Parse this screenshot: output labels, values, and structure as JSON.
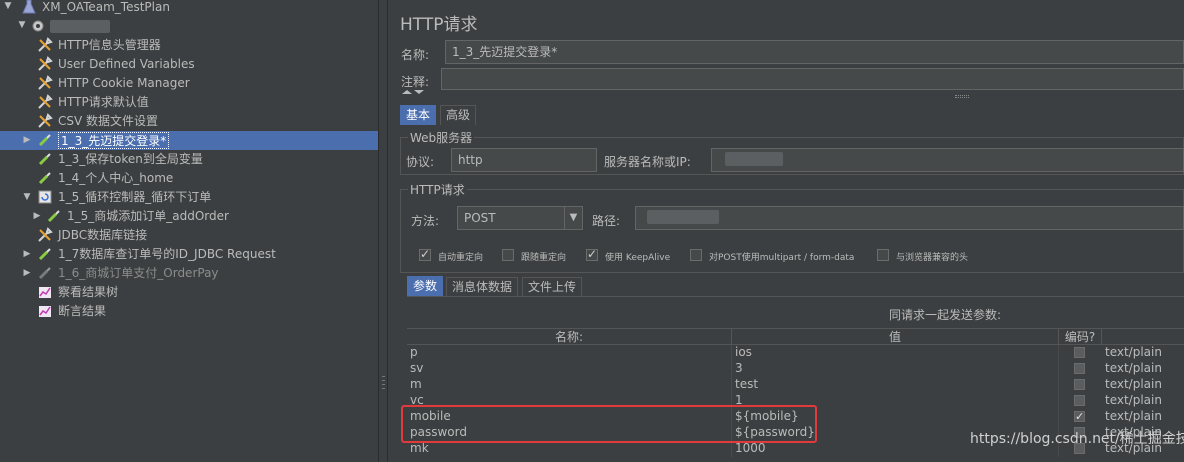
{
  "tree": {
    "items": [
      {
        "label": "XM_OATeam_TestPlan",
        "icon": "flask-icon"
      },
      {
        "label": "",
        "icon": "gear-icon"
      },
      {
        "label": "HTTP信息头管理器",
        "icon": "wrench-icon"
      },
      {
        "label": "User Defined Variables",
        "icon": "wrench-icon"
      },
      {
        "label": "HTTP Cookie Manager",
        "icon": "wrench-icon"
      },
      {
        "label": "HTTP请求默认值",
        "icon": "wrench-icon"
      },
      {
        "label": "CSV 数据文件设置",
        "icon": "wrench-icon"
      },
      {
        "label": "1_3_先迈提交登录*",
        "icon": "pipette-icon"
      },
      {
        "label": "1_3_保存token到全局变量",
        "icon": "pipette-icon"
      },
      {
        "label": "1_4_个人中心_home",
        "icon": "pipette-icon"
      },
      {
        "label": "1_5_循环控制器_循环下订单",
        "icon": "loop-icon"
      },
      {
        "label": "1_5_商城添加订单_addOrder",
        "icon": "pipette-icon"
      },
      {
        "label": "JDBC数据库链接",
        "icon": "wrench-icon"
      },
      {
        "label": "1_7数据库查订单号的ID_JDBC Request",
        "icon": "pipette-icon"
      },
      {
        "label": "1_6_商城订单支付_OrderPay",
        "icon": "pipette-icon"
      },
      {
        "label": "察看结果树",
        "icon": "graph-icon"
      },
      {
        "label": "断言结果",
        "icon": "graph-icon"
      }
    ]
  },
  "panel": {
    "title": "HTTP请求",
    "name_label": "名称:",
    "name_value": "1_3_先迈提交登录*",
    "comment_label": "注释:",
    "tabs": [
      "基本",
      "高级"
    ],
    "web_server": {
      "title": "Web服务器",
      "protocol_label": "协议:",
      "protocol_value": "http",
      "server_label": "服务器名称或IP:"
    },
    "http_request": {
      "title": "HTTP请求",
      "method_label": "方法:",
      "method_value": "POST",
      "path_label": "路径:",
      "options": [
        {
          "label": "自动重定向",
          "checked": true
        },
        {
          "label": "跟随重定向",
          "checked": false
        },
        {
          "label": "使用 KeepAlive",
          "checked": true
        },
        {
          "label": "对POST使用multipart / form-data",
          "checked": false
        },
        {
          "label": "与浏览器兼容的头",
          "checked": false
        }
      ]
    },
    "sub_tabs": [
      "参数",
      "消息体数据",
      "文件上传"
    ],
    "params": {
      "caption": "同请求一起发送参数:",
      "headers": [
        "名称:",
        "值",
        "编码?",
        ""
      ],
      "rows": [
        {
          "name": "p",
          "value": "ios",
          "encode": false,
          "type": "text/plain"
        },
        {
          "name": "sv",
          "value": "3",
          "encode": false,
          "type": "text/plain"
        },
        {
          "name": "m",
          "value": "test",
          "encode": false,
          "type": "text/plain"
        },
        {
          "name": "vc",
          "value": "1",
          "encode": false,
          "type": "text/plain"
        },
        {
          "name": "mobile",
          "value": "${mobile}",
          "encode": true,
          "type": "text/plain"
        },
        {
          "name": "password",
          "value": "${password}",
          "encode": false,
          "type": "text/plain"
        },
        {
          "name": "mk",
          "value": "1000",
          "encode": false,
          "type": "text/plain"
        }
      ]
    },
    "watermark": "https://blog.csdn.net/稀土掘金技术社区"
  },
  "colors": {
    "background": "#3c3f41",
    "selection": "#4b6eaf",
    "highlight_box": "#e23a3a"
  }
}
